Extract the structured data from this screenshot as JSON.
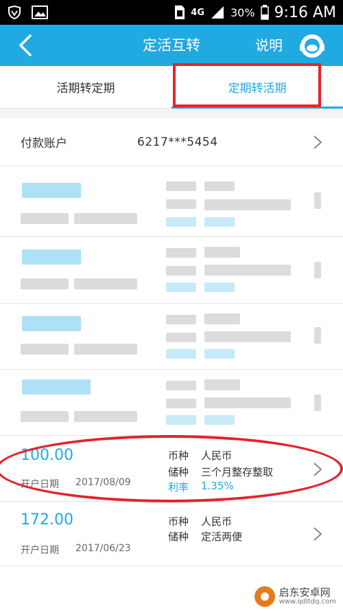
{
  "status_bar": {
    "network": "4G",
    "battery": "30%",
    "time": "9:16 AM",
    "icons": [
      "shield-icon",
      "image-icon",
      "sim-icon",
      "signal-icon",
      "battery-icon"
    ]
  },
  "header": {
    "title": "定活互转",
    "help_label": "说明",
    "icons": [
      "back-arrow-icon",
      "customer-service-icon"
    ],
    "color": "#21a9e1"
  },
  "tabs": [
    {
      "label": "活期转定期",
      "active": false
    },
    {
      "label": "定期转活期",
      "active": true
    }
  ],
  "account": {
    "label": "付款账户",
    "number": "6217***5454"
  },
  "deposits": [
    {
      "amount": "100.00",
      "open_date_label": "开户日期",
      "open_date": "2017/08/09",
      "currency_label": "币种",
      "currency": "人民币",
      "type_label": "储种",
      "type": "三个月整存整取",
      "rate_label": "利率",
      "rate": "1.35%"
    },
    {
      "amount": "172.00",
      "open_date_label": "开户日期",
      "open_date": "2017/06/23",
      "currency_label": "币种",
      "currency": "人民币",
      "type_label": "储种",
      "type": "定活两便"
    }
  ],
  "watermark": {
    "name": "启东安卓网",
    "url": "www.qdltdq.com"
  },
  "colors": {
    "accent": "#21a9e1",
    "annotation_red": "#e3232a"
  }
}
